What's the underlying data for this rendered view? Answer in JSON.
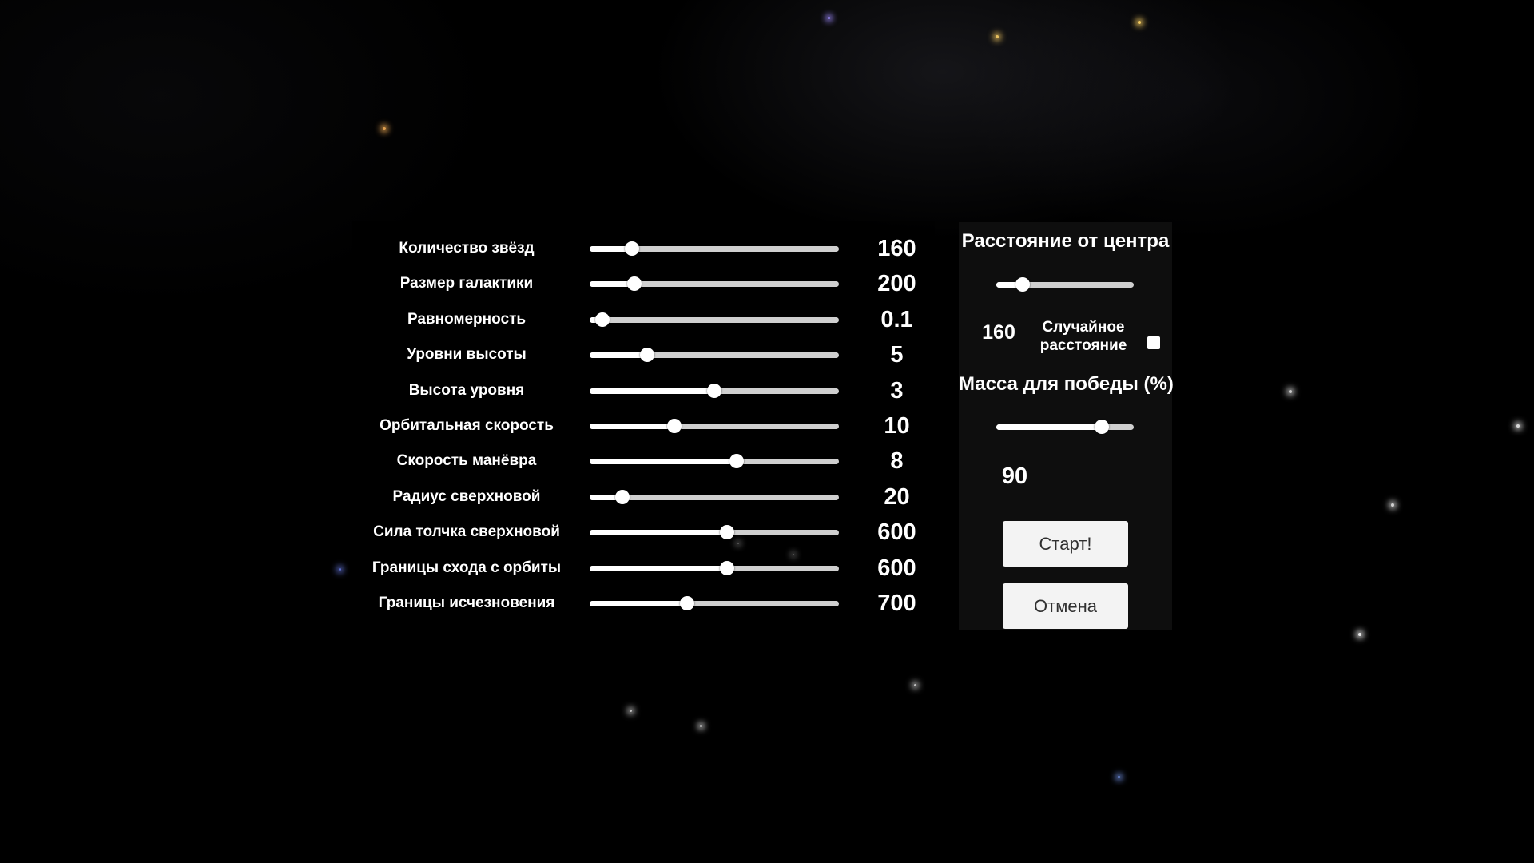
{
  "settings": [
    {
      "label": "Количество звёзд",
      "value": "160",
      "level": 0.17
    },
    {
      "label": "Размер галактики",
      "value": "200",
      "level": 0.18
    },
    {
      "label": "Равномерность",
      "value": "0.1",
      "level": 0.05
    },
    {
      "label": "Уровни высоты",
      "value": "5",
      "level": 0.23
    },
    {
      "label": "Высота уровня",
      "value": "3",
      "level": 0.5
    },
    {
      "label": "Орбитальная скорость",
      "value": "10",
      "level": 0.34
    },
    {
      "label": "Скорость манёвра",
      "value": "8",
      "level": 0.59
    },
    {
      "label": "Радиус сверхновой",
      "value": "20",
      "level": 0.13
    },
    {
      "label": "Сила толчка сверхновой",
      "value": "600",
      "level": 0.55
    },
    {
      "label": "Границы схода с орбиты",
      "value": "600",
      "level": 0.55
    },
    {
      "label": "Границы исчезновения",
      "value": "700",
      "level": 0.39
    }
  ],
  "distance": {
    "title": "Расстояние от центра",
    "value": "160",
    "level": 0.19,
    "random_label": "Случайное расстояние",
    "random_checked": false
  },
  "mass": {
    "title": "Масса для победы (%)",
    "value": "90",
    "level": 0.77
  },
  "buttons": {
    "start": "Старт!",
    "cancel": "Отмена"
  },
  "colors": {
    "background": "#000000",
    "text": "#ffffff",
    "button_bg": "#f3f3f3",
    "button_text": "#303030"
  }
}
